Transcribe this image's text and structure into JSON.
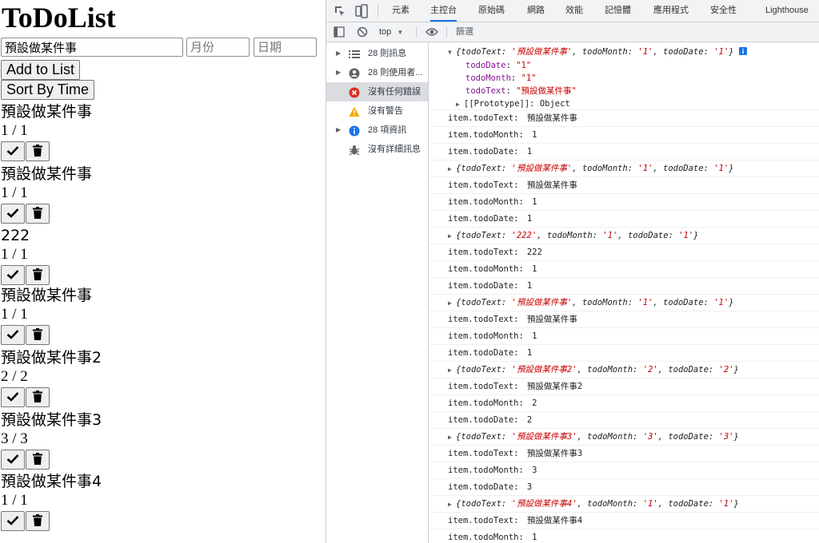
{
  "app": {
    "title": "ToDoList",
    "text_input_value": "預設做某件事",
    "month_placeholder": "月份",
    "date_placeholder": "日期",
    "add_label": "Add to List",
    "sort_label": "Sort By Time",
    "items": [
      {
        "text": "預設做某件事",
        "date": "1 / 1"
      },
      {
        "text": "預設做某件事",
        "date": "1 / 1"
      },
      {
        "text": "222",
        "date": "1 / 1"
      },
      {
        "text": "預設做某件事",
        "date": "1 / 1"
      },
      {
        "text": "預設做某件事2",
        "date": "2 / 2"
      },
      {
        "text": "預設做某件事3",
        "date": "3 / 3"
      },
      {
        "text": "預設做某件事4",
        "date": "1 / 1"
      }
    ]
  },
  "devtools": {
    "tabs": [
      "元素",
      "主控台",
      "原始碼",
      "網路",
      "效能",
      "記憶體",
      "應用程式",
      "安全性",
      "Lighthouse"
    ],
    "active_tab": "主控台",
    "context": "top",
    "filter_placeholder": "篩選",
    "sidebar": [
      {
        "label": "28 則訊息",
        "icon": "list-icon"
      },
      {
        "label": "28 則使用者...",
        "icon": "user-icon"
      },
      {
        "label": "沒有任何錯誤",
        "icon": "error-icon"
      },
      {
        "label": "沒有警告",
        "icon": "warning-icon"
      },
      {
        "label": "28 項資訊",
        "icon": "info-icon"
      },
      {
        "label": "沒有詳細訊息",
        "icon": "bug-icon"
      }
    ],
    "expanded": {
      "summary": [
        "{todoText: ",
        "'預設做某件事'",
        ", todoMonth: ",
        "'1'",
        ", todoDate: ",
        "'1'",
        "}"
      ],
      "props": [
        {
          "key": "todoDate",
          "value": "\"1\""
        },
        {
          "key": "todoMonth",
          "value": "\"1\""
        },
        {
          "key": "todoText",
          "value": "\"預設做某件事\""
        }
      ],
      "proto": "[[Prototype]]: Object"
    },
    "log_labels": {
      "text": "item.todoText: ",
      "month": "item.todoMonth: ",
      "date": "item.todoDate: "
    },
    "groups": [
      {
        "text": "預設做某件事",
        "month": "1",
        "date": "1",
        "show_object": false
      },
      {
        "text": "預設做某件事",
        "month": "1",
        "date": "1",
        "show_object": true
      },
      {
        "text": "222",
        "month": "1",
        "date": "1",
        "show_object": true
      },
      {
        "text": "預設做某件事",
        "month": "1",
        "date": "1",
        "show_object": true
      },
      {
        "text": "預設做某件事2",
        "month": "2",
        "date": "2",
        "show_object": true
      },
      {
        "text": "預設做某件事3",
        "month": "3",
        "date": "3",
        "show_object": true
      },
      {
        "text": "預設做某件事4",
        "month": "1",
        "date": "1",
        "show_object": true
      }
    ],
    "colors": {
      "accent": "#1a73e8",
      "string": "#c80000",
      "property": "#881391",
      "error": "#d93025",
      "warning": "#f9ab00",
      "info": "#1a73e8"
    }
  }
}
